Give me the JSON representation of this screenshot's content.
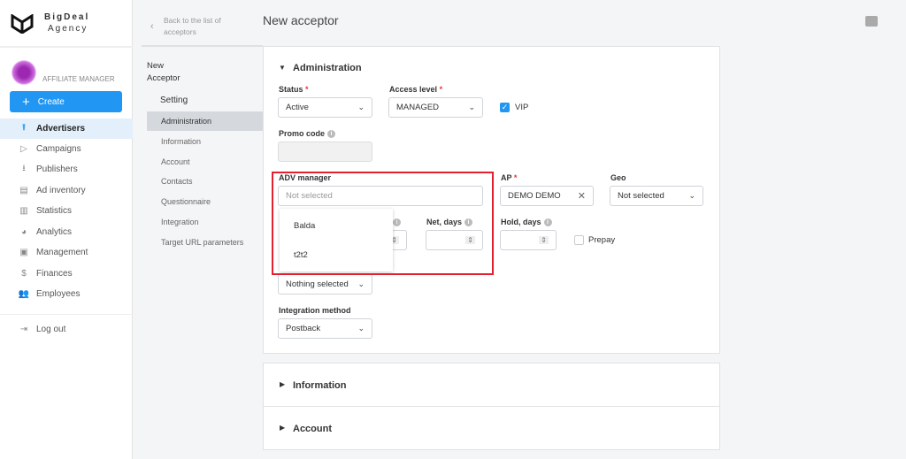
{
  "brand": {
    "line1": "BigDeal",
    "line2": "Agency",
    "role": "AFFILIATE MANAGER"
  },
  "create_label": "Create",
  "nav": [
    {
      "label": "Advertisers",
      "icon": "upload-icon",
      "glyph": "⭱"
    },
    {
      "label": "Campaigns",
      "icon": "play-circle-icon",
      "glyph": "▷"
    },
    {
      "label": "Publishers",
      "icon": "download-icon",
      "glyph": "⭳"
    },
    {
      "label": "Ad inventory",
      "icon": "calendar-icon",
      "glyph": "▤"
    },
    {
      "label": "Statistics",
      "icon": "bar-chart-icon",
      "glyph": "▥"
    },
    {
      "label": "Analytics",
      "icon": "pie-chart-icon",
      "glyph": "◕"
    },
    {
      "label": "Management",
      "icon": "settings-box-icon",
      "glyph": "▣"
    },
    {
      "label": "Finances",
      "icon": "dollar-icon",
      "glyph": "$"
    },
    {
      "label": "Employees",
      "icon": "people-icon",
      "glyph": "👥"
    }
  ],
  "logout": "Log out",
  "back": {
    "line1": "Back to the list of",
    "line2": "acceptors"
  },
  "sub": {
    "title1": "New",
    "title2": "Acceptor",
    "section": "Setting",
    "items": [
      "Administration",
      "Information",
      "Account",
      "Contacts",
      "Questionnaire",
      "Integration",
      "Target URL parameters"
    ]
  },
  "page_title": "New acceptor",
  "admin": {
    "title": "Administration",
    "status": {
      "label": "Status",
      "value": "Active"
    },
    "access": {
      "label": "Access level",
      "value": "MANAGED"
    },
    "vip": {
      "label": "VIP",
      "checked": true
    },
    "promo": {
      "label": "Promo code",
      "value": ""
    },
    "adv": {
      "label": "ADV manager",
      "placeholder": "Not selected",
      "options": [
        "Balda",
        "t2t2"
      ]
    },
    "ap": {
      "label": "AP",
      "value": "DEMO DEMO"
    },
    "geo": {
      "label": "Geo",
      "value": "Not selected"
    },
    "net": {
      "label": "Net, days"
    },
    "hold": {
      "label": "Hold, days"
    },
    "prepay": {
      "label": "Prepay",
      "checked": false
    },
    "nothing": {
      "value": "Nothing selected"
    },
    "integration": {
      "label": "Integration method",
      "value": "Postback"
    }
  },
  "sections": [
    "Information",
    "Account"
  ],
  "colors": {
    "accent": "#2196f3",
    "highlight": "#e5202e"
  }
}
